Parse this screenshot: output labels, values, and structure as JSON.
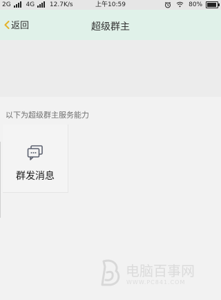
{
  "status_bar": {
    "network_primary": "2G",
    "network_secondary": "4G",
    "speed": "12.7K/s",
    "time": "上午10:59",
    "battery": "80%"
  },
  "nav": {
    "back_label": "返回",
    "title": "超级群主"
  },
  "section_label": "以下为超级群主服务能力",
  "feature": {
    "label": "群发消息",
    "icon": "message-dots-icon"
  },
  "watermark": {
    "title": "电脑百事网",
    "url": "WWW.PC841.COM",
    "logo": "stylized-b-logo"
  }
}
